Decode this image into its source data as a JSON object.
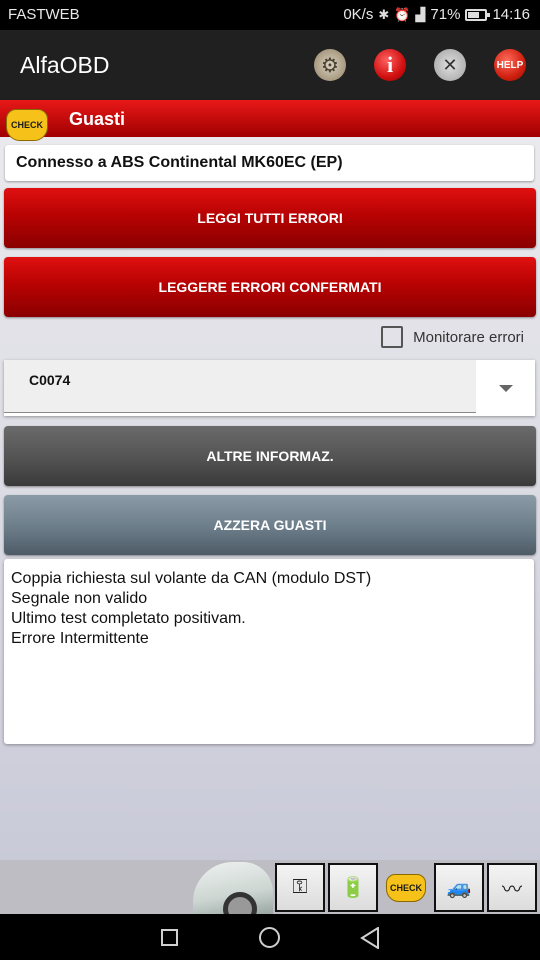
{
  "status_bar": {
    "carrier": "FASTWEB",
    "speed": "0K/s",
    "battery_percent": "71%",
    "battery_level": 0.71,
    "time": "14:16",
    "icons": [
      "bluetooth-icon",
      "alarm-icon",
      "signal-icon",
      "battery-icon"
    ]
  },
  "app_bar": {
    "title": "AlfaOBD",
    "actions": [
      {
        "name": "settings",
        "icon": "gear-icon"
      },
      {
        "name": "info",
        "icon": "info-icon",
        "label": "i"
      },
      {
        "name": "tools",
        "icon": "tools-icon"
      },
      {
        "name": "help",
        "icon": "help-icon",
        "label": "HELP"
      }
    ]
  },
  "section": {
    "badge": "CHECK",
    "title": "Guasti"
  },
  "connection_text": "Connesso a ABS Continental MK60EC (EP)",
  "buttons": {
    "read_all": "LEGGI TUTTI ERRORI",
    "read_confirmed": "LEGGERE ERRORI CONFERMATI",
    "more_info": "ALTRE INFORMAZ.",
    "clear": "AZZERA GUASTI"
  },
  "monitor": {
    "label": "Monitorare errori",
    "checked": false
  },
  "error_select": {
    "selected": "C0074"
  },
  "details": {
    "lines": [
      "Coppia richiesta sul volante da CAN (modulo DST)",
      "Segnale non valido",
      "Ultimo test completato positivam.",
      "Errore Intermittente"
    ]
  },
  "toolbar": {
    "badge": "CHECK",
    "items": [
      "car-image",
      "key-icon",
      "battery-icon",
      "check-engine-icon",
      "vehicle-icon",
      "waveform-icon"
    ]
  },
  "colors": {
    "header_red": "#c00000",
    "button_red": "#b80202",
    "button_grey": "#555555",
    "button_slate": "#6f808d",
    "check_yellow": "#f6c21a"
  }
}
